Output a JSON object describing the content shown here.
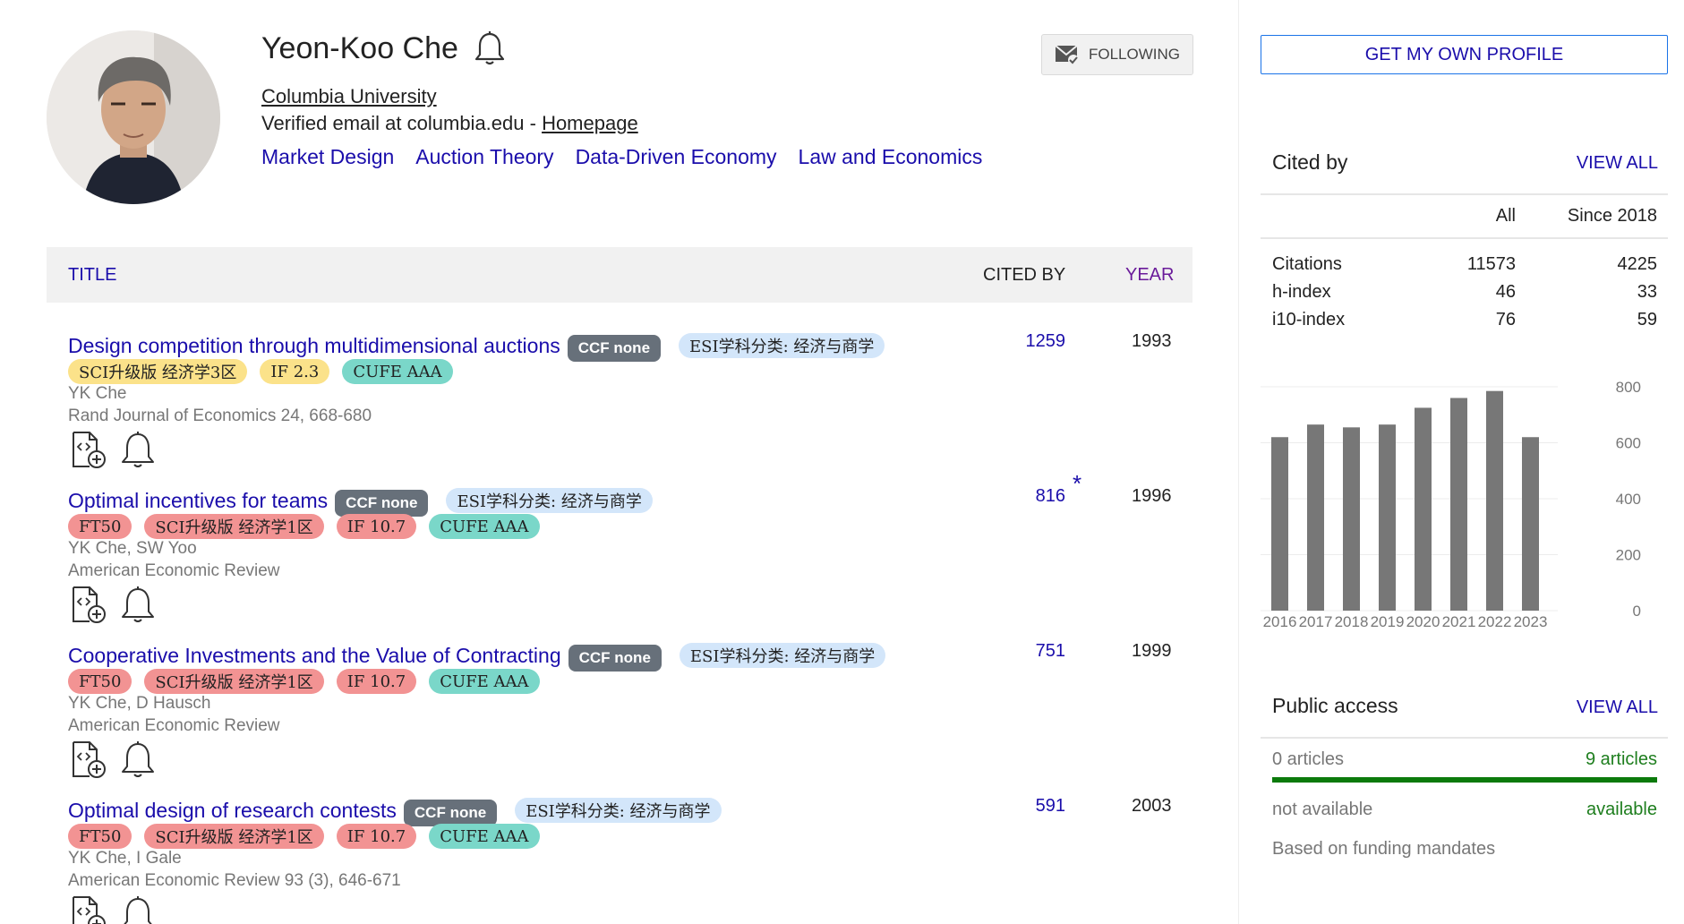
{
  "profile": {
    "name": "Yeon-Koo Che",
    "affiliation": "Columbia University",
    "email_text": "Verified email at columbia.edu - ",
    "homepage_label": "Homepage",
    "follow_label": "FOLLOWING",
    "interests": [
      "Market Design",
      "Auction Theory",
      "Data-Driven Economy",
      "Law and Economics"
    ]
  },
  "table": {
    "title_header": "TITLE",
    "cited_header": "CITED BY",
    "year_header": "YEAR"
  },
  "articles": [
    {
      "title": "Design competition through multidimensional auctions",
      "ccf": "CCF none",
      "esi": "ESI学科分类: 经济与商学",
      "badges": [
        {
          "text": "SCI升级版 经济学3区",
          "color": "yellow"
        },
        {
          "text": "IF 2.3",
          "color": "yellow"
        },
        {
          "text": "CUFE AAA",
          "color": "teal"
        }
      ],
      "authors": "YK Che",
      "venue": "Rand Journal of Economics 24, 668-680",
      "cited_by": "1259",
      "star": "",
      "year": "1993"
    },
    {
      "title": "Optimal incentives for teams",
      "ccf": "CCF none",
      "esi": "ESI学科分类: 经济与商学",
      "badges": [
        {
          "text": "FT50",
          "color": "red"
        },
        {
          "text": "SCI升级版 经济学1区",
          "color": "red"
        },
        {
          "text": "IF 10.7",
          "color": "red"
        },
        {
          "text": "CUFE AAA",
          "color": "teal"
        }
      ],
      "authors": "YK Che, SW Yoo",
      "venue": "American Economic Review",
      "cited_by": "816",
      "star": "*",
      "year": "1996"
    },
    {
      "title": "Cooperative Investments and the Value of Contracting",
      "ccf": "CCF none",
      "esi": "ESI学科分类: 经济与商学",
      "badges": [
        {
          "text": "FT50",
          "color": "red"
        },
        {
          "text": "SCI升级版 经济学1区",
          "color": "red"
        },
        {
          "text": "IF 10.7",
          "color": "red"
        },
        {
          "text": "CUFE AAA",
          "color": "teal"
        }
      ],
      "authors": "YK Che, D Hausch",
      "venue": "American Economic Review",
      "cited_by": "751",
      "star": "",
      "year": "1999"
    },
    {
      "title": "Optimal design of research contests",
      "ccf": "CCF none",
      "esi": "ESI学科分类: 经济与商学",
      "badges": [
        {
          "text": "FT50",
          "color": "red"
        },
        {
          "text": "SCI升级版 经济学1区",
          "color": "red"
        },
        {
          "text": "IF 10.7",
          "color": "red"
        },
        {
          "text": "CUFE AAA",
          "color": "teal"
        }
      ],
      "authors": "YK Che, I Gale",
      "venue": "American Economic Review 93 (3), 646-671",
      "cited_by": "591",
      "star": "",
      "year": "2003"
    }
  ],
  "sidebar": {
    "get_profile_label": "GET MY OWN PROFILE",
    "cited_by": {
      "title": "Cited by",
      "view_all": "VIEW ALL",
      "col_all": "All",
      "col_since": "Since 2018",
      "rows": [
        {
          "label": "Citations",
          "all": "11573",
          "since": "4225"
        },
        {
          "label": "h-index",
          "all": "46",
          "since": "33"
        },
        {
          "label": "i10-index",
          "all": "76",
          "since": "59"
        }
      ]
    },
    "public_access": {
      "title": "Public access",
      "view_all": "VIEW ALL",
      "left_count": "0 articles",
      "right_count": "9 articles",
      "left_status": "not available",
      "right_status": "available",
      "note": "Based on funding mandates"
    }
  },
  "chart_data": {
    "type": "bar",
    "categories": [
      "2016",
      "2017",
      "2018",
      "2019",
      "2020",
      "2021",
      "2022",
      "2023"
    ],
    "values": [
      620,
      665,
      655,
      665,
      725,
      760,
      785,
      620
    ],
    "y_ticks": [
      "800",
      "600",
      "400",
      "200",
      "0"
    ],
    "ylim": [
      0,
      800
    ],
    "bar_color": "#777777",
    "grid": true
  },
  "colors": {
    "link": "#1a0dab",
    "ccf_badge": "#67707a",
    "esi_badge": "#d3e6fa",
    "yellow_badge": "#fbe28a",
    "red_badge": "#f29393",
    "teal_badge": "#7ad7c9",
    "access_green": "#0b7a0b"
  }
}
